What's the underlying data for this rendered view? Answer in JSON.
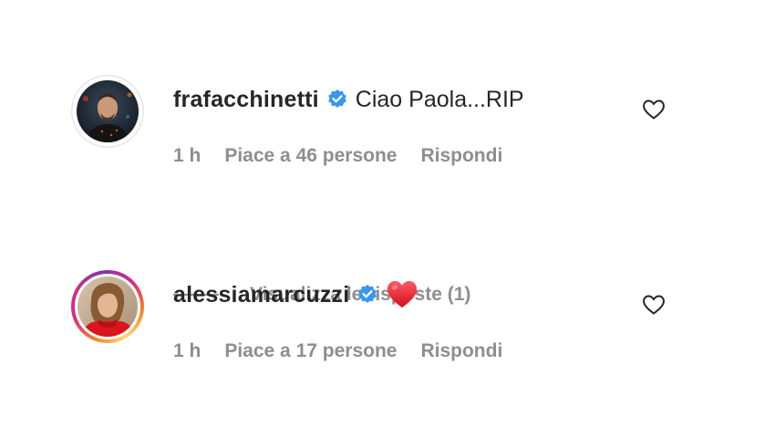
{
  "comments": [
    {
      "username": "frafacchinetti",
      "text": "Ciao Paola...RIP",
      "time": "1 h",
      "likes": "Piace a 46 persone",
      "reply": "Rispondi",
      "view_replies": "Visualizza le risposte (1)",
      "avatar_icon": "profile-photo-man",
      "verified_icon": "verified-badge-icon",
      "like_icon": "heart-outline-icon"
    },
    {
      "username": "alessiamarcuzzi",
      "text": "",
      "emoji": "red-heart-emoji",
      "time": "1 h",
      "likes": "Piace a 17 persone",
      "reply": "Rispondi",
      "avatar_icon": "profile-photo-woman",
      "verified_icon": "verified-badge-icon",
      "like_icon": "heart-outline-icon",
      "has_story_ring": true
    }
  ],
  "colors": {
    "text_primary": "#262626",
    "text_secondary": "#8e8e8e",
    "verified_blue": "#3897f0",
    "emoji_red": "#e0212b"
  }
}
